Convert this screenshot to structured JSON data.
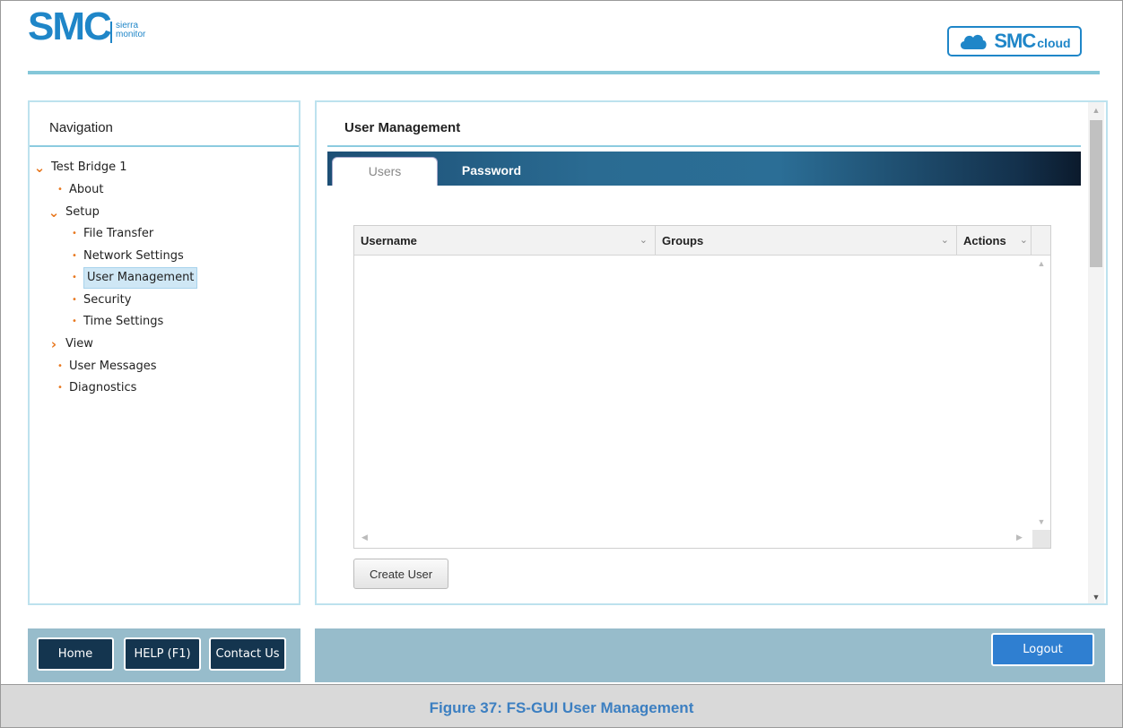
{
  "header": {
    "logo_text": "SMC",
    "logo_badge_line1": "sierra",
    "logo_badge_line2": "monitor",
    "cloud_logo_text": "SMC",
    "cloud_logo_sub": "cloud"
  },
  "navigation": {
    "title": "Navigation",
    "items": [
      {
        "label": "Test Bridge 1",
        "kind": "expanded",
        "level": 0
      },
      {
        "label": "About",
        "kind": "leaf",
        "level": 1
      },
      {
        "label": "Setup",
        "kind": "expanded",
        "level": 1
      },
      {
        "label": "File Transfer",
        "kind": "leaf",
        "level": 2
      },
      {
        "label": "Network Settings",
        "kind": "leaf",
        "level": 2
      },
      {
        "label": "User Management",
        "kind": "leaf",
        "level": 2,
        "selected": true
      },
      {
        "label": "Security",
        "kind": "leaf",
        "level": 2
      },
      {
        "label": "Time Settings",
        "kind": "leaf",
        "level": 2
      },
      {
        "label": "View",
        "kind": "collapsed",
        "level": 1
      },
      {
        "label": "User Messages",
        "kind": "leaf",
        "level": 1
      },
      {
        "label": "Diagnostics",
        "kind": "leaf",
        "level": 1
      }
    ]
  },
  "content": {
    "title": "User Management",
    "tabs": [
      {
        "label": "Users",
        "active": true
      },
      {
        "label": "Password",
        "active": false
      }
    ],
    "table": {
      "columns": [
        "Username",
        "Groups",
        "Actions"
      ],
      "rows": []
    },
    "create_button": "Create User"
  },
  "footer": {
    "home": "Home",
    "help": "HELP (F1)",
    "contact": "Contact Us",
    "logout": "Logout"
  },
  "caption": "Figure 37: FS-GUI User Management",
  "colors": {
    "brand_blue": "#1f86c8",
    "accent_orange": "#e8781f",
    "footer_bar": "#97bccb",
    "footer_button": "#14354f",
    "logout_button": "#2f7fd1",
    "caption_text": "#3c7fc1"
  }
}
